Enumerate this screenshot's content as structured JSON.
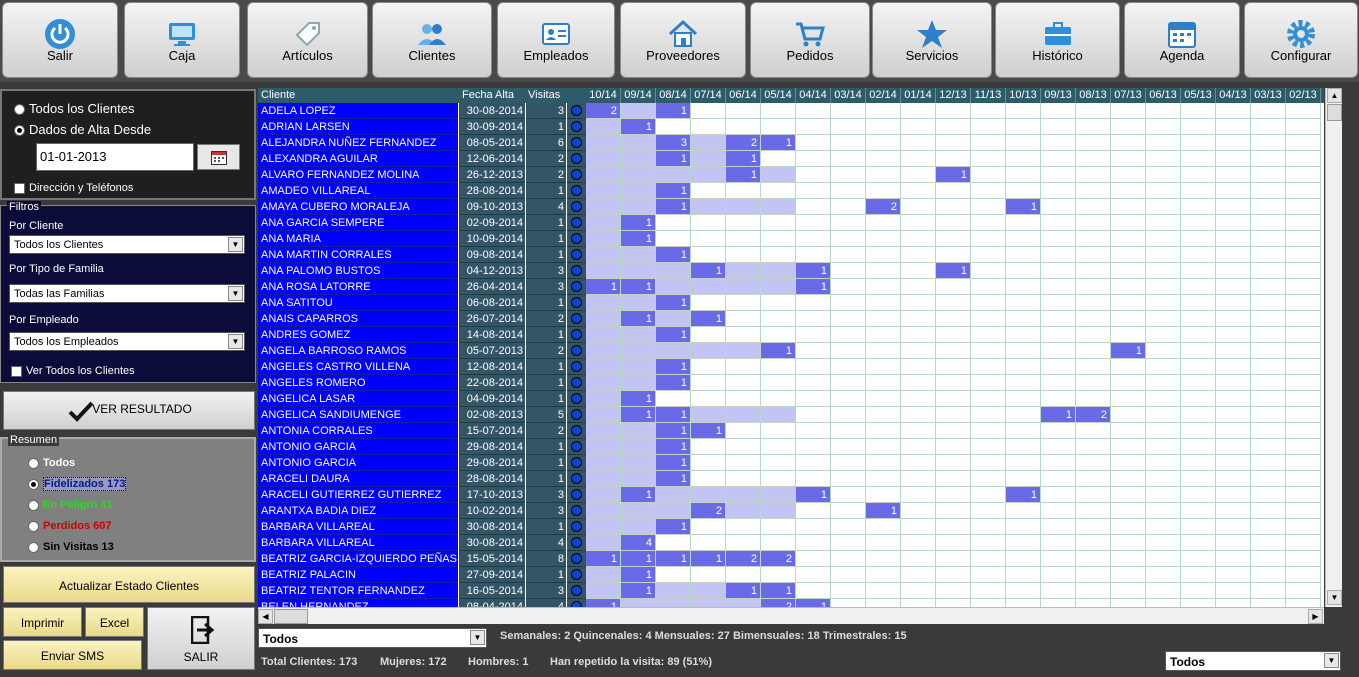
{
  "toolbar": {
    "items": [
      {
        "label": "Salir",
        "icon": "power-icon"
      },
      {
        "label": "Caja",
        "icon": "monitor-icon"
      },
      {
        "label": "Artículos",
        "icon": "tag-icon"
      },
      {
        "label": "Clientes",
        "icon": "users-icon"
      },
      {
        "label": "Empleados",
        "icon": "id-card-icon"
      },
      {
        "label": "Proveedores",
        "icon": "house-icon"
      },
      {
        "label": "Pedidos",
        "icon": "cart-icon"
      },
      {
        "label": "Servicios",
        "icon": "star-icon"
      },
      {
        "label": "Histórico",
        "icon": "briefcase-icon"
      },
      {
        "label": "Agenda",
        "icon": "calendar-icon"
      },
      {
        "label": "Configurar",
        "icon": "gear-icon"
      }
    ]
  },
  "client_filter": {
    "all_clients": "Todos los Clientes",
    "alta_desde": "Dados de Alta Desde",
    "date_value": "01-01-2013",
    "direccion": "Dirección y Teléfonos"
  },
  "filtros": {
    "title": "Filtros",
    "por_cliente": "Por Cliente",
    "por_cliente_value": "Todos los Clientes",
    "por_familia": "Por Tipo de Familia",
    "por_familia_value": "Todas las Familias",
    "por_empleado": "Por Empleado",
    "por_empleado_value": "Todos los Empleados",
    "ver_todos": "Ver Todos los Clientes"
  },
  "ver_resultado": "VER RESULTADO",
  "resumen": {
    "title": "Resumen",
    "todos": "Todos",
    "fidelizados": "Fidelizados 173",
    "peligro": "En Peligro 41",
    "perdidos": "Perdidos 607",
    "sin_visitas": "Sin Visitas 13"
  },
  "buttons": {
    "actualizar": "Actualizar Estado Clientes",
    "imprimir": "Imprimir",
    "excel": "Excel",
    "sms": "Enviar SMS",
    "salir": "SALIR"
  },
  "grid": {
    "headers": {
      "cliente": "Cliente",
      "fecha": "Fecha Alta",
      "visitas": "Visitas"
    },
    "months": [
      "10/14",
      "09/14",
      "08/14",
      "07/14",
      "06/14",
      "05/14",
      "04/14",
      "03/14",
      "02/14",
      "01/14",
      "12/13",
      "11/13",
      "10/13",
      "09/13",
      "08/13",
      "07/13",
      "06/13",
      "05/13",
      "04/13",
      "03/13",
      "02/13"
    ],
    "rows": [
      {
        "name": "ADELA  LOPEZ",
        "date": "30-08-2014",
        "visits": "3",
        "cells": {
          "0": "2",
          "2": "1"
        }
      },
      {
        "name": "ADRIAN LARSEN",
        "date": "30-09-2014",
        "visits": "1",
        "cells": {
          "1": "1"
        }
      },
      {
        "name": "ALEJANDRA NUÑEZ FERNANDEZ",
        "date": "08-05-2014",
        "visits": "6",
        "cells": {
          "2": "3",
          "4": "2",
          "5": "1"
        }
      },
      {
        "name": "ALEXANDRA AGUILAR",
        "date": "12-06-2014",
        "visits": "2",
        "cells": {
          "2": "1",
          "4": "1"
        }
      },
      {
        "name": "ALVARO FERNANDEZ MOLINA",
        "date": "26-12-2013",
        "visits": "2",
        "cells": {
          "4": "1",
          "10": "1"
        }
      },
      {
        "name": "AMADEO VILLAREAL",
        "date": "28-08-2014",
        "visits": "1",
        "cells": {
          "2": "1"
        }
      },
      {
        "name": "AMAYA CUBERO MORALEJA",
        "date": "09-10-2013",
        "visits": "4",
        "cells": {
          "2": "1",
          "8": "2",
          "12": "1"
        }
      },
      {
        "name": "ANA GARCIA SEMPERE",
        "date": "02-09-2014",
        "visits": "1",
        "cells": {
          "1": "1"
        }
      },
      {
        "name": "ANA MARIA",
        "date": "10-09-2014",
        "visits": "1",
        "cells": {
          "1": "1"
        }
      },
      {
        "name": "ANA MARTIN CORRALES",
        "date": "09-08-2014",
        "visits": "1",
        "cells": {
          "2": "1"
        }
      },
      {
        "name": "ANA PALOMO BUSTOS",
        "date": "04-12-2013",
        "visits": "3",
        "cells": {
          "3": "1",
          "6": "1",
          "10": "1"
        }
      },
      {
        "name": "ANA ROSA LATORRE",
        "date": "26-04-2014",
        "visits": "3",
        "cells": {
          "0": "1",
          "1": "1",
          "6": "1"
        }
      },
      {
        "name": "ANA SATITOU",
        "date": "06-08-2014",
        "visits": "1",
        "cells": {
          "2": "1"
        }
      },
      {
        "name": "ANAIS CAPARROS",
        "date": "26-07-2014",
        "visits": "2",
        "cells": {
          "1": "1",
          "3": "1"
        }
      },
      {
        "name": "ANDRES  GOMEZ",
        "date": "14-08-2014",
        "visits": "1",
        "cells": {
          "2": "1"
        }
      },
      {
        "name": "ANGELA BARROSO RAMOS",
        "date": "05-07-2013",
        "visits": "2",
        "cells": {
          "5": "1",
          "15": "1"
        }
      },
      {
        "name": "ANGELES CASTRO VILLENA",
        "date": "12-08-2014",
        "visits": "1",
        "cells": {
          "2": "1"
        }
      },
      {
        "name": "ANGELES ROMERO",
        "date": "22-08-2014",
        "visits": "1",
        "cells": {
          "2": "1"
        }
      },
      {
        "name": "ANGELICA LASAR",
        "date": "04-09-2014",
        "visits": "1",
        "cells": {
          "1": "1"
        }
      },
      {
        "name": "ANGELICA SANDIUMENGE",
        "date": "02-08-2013",
        "visits": "5",
        "cells": {
          "1": "1",
          "2": "1",
          "13": "1",
          "14": "2"
        }
      },
      {
        "name": "ANTONIA CORRALES",
        "date": "15-07-2014",
        "visits": "2",
        "cells": {
          "2": "1",
          "3": "1"
        }
      },
      {
        "name": "ANTONIO GARCIA",
        "date": "29-08-2014",
        "visits": "1",
        "cells": {
          "2": "1"
        }
      },
      {
        "name": "ANTONIO GARCIA",
        "date": "29-08-2014",
        "visits": "1",
        "cells": {
          "2": "1"
        }
      },
      {
        "name": "ARACELI DAURA",
        "date": "28-08-2014",
        "visits": "1",
        "cells": {
          "2": "1"
        }
      },
      {
        "name": "ARACELI GUTIERREZ GUTIERREZ",
        "date": "17-10-2013",
        "visits": "3",
        "cells": {
          "1": "1",
          "6": "1",
          "12": "1"
        }
      },
      {
        "name": "ARANTXA BADIA DIEZ",
        "date": "10-02-2014",
        "visits": "3",
        "cells": {
          "3": "2",
          "8": "1"
        }
      },
      {
        "name": "BARBARA  VILLAREAL",
        "date": "30-08-2014",
        "visits": "1",
        "cells": {
          "2": "1"
        }
      },
      {
        "name": "BARBARA VILLAREAL",
        "date": "30-08-2014",
        "visits": "4",
        "cells": {
          "1": "4"
        }
      },
      {
        "name": "BEATRIZ GARCIA-IZQUIERDO PEÑAS",
        "date": "15-05-2014",
        "visits": "8",
        "cells": {
          "0": "1",
          "1": "1",
          "2": "1",
          "3": "1",
          "4": "2",
          "5": "2"
        }
      },
      {
        "name": "BEATRIZ PALACIN",
        "date": "27-09-2014",
        "visits": "1",
        "cells": {
          "1": "1"
        }
      },
      {
        "name": "BEATRIZ TENTOR FERNANDEZ",
        "date": "16-05-2014",
        "visits": "3",
        "cells": {
          "1": "1",
          "4": "1",
          "5": "1"
        }
      },
      {
        "name": "BELEN HERNANDEZ",
        "date": "08-04-2014",
        "visits": "4",
        "cells": {
          "0": "1",
          "5": "2",
          "6": "1"
        }
      }
    ]
  },
  "bottom": {
    "todos_left": "Todos",
    "stats_line1": "Semanales: 2 Quincenales: 4 Mensuales: 27 Bimensuales: 18 Trimestrales: 15",
    "total": "Total Clientes: 173",
    "mujeres": "Mujeres: 172",
    "hombres": "Hombres: 1",
    "repetido": "Han repetido la visita: 89 (51%)",
    "todos_right": "Todos"
  }
}
